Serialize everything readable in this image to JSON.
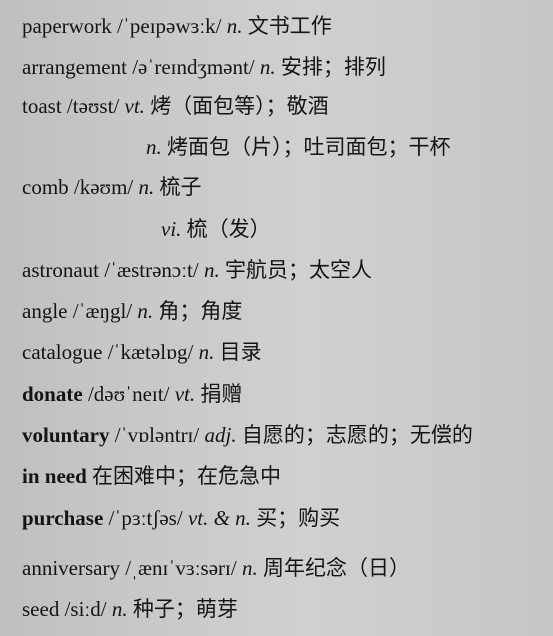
{
  "entries": [
    {
      "word": "paperwork",
      "phonetic": "/ˈpeɪpəwɜːk/",
      "pos": "n.",
      "meaning": "文书工作",
      "bold": false
    },
    {
      "word": "arrangement",
      "phonetic": "/əˈreɪndʒmənt/",
      "pos": "n.",
      "meaning": "安排；排列",
      "bold": false
    },
    {
      "word": "toast",
      "phonetic": "/təʊst/",
      "pos": "vt.",
      "meaning": "烤（面包等）；敬酒",
      "bold": false
    },
    {
      "word": "",
      "phonetic": "",
      "pos": "n.",
      "meaning": "烤面包（片）；吐司面包；干杯",
      "bold": false
    },
    {
      "word": "comb",
      "phonetic": "/kəʊm/",
      "pos": "n.",
      "meaning": "梳子",
      "bold": false
    },
    {
      "word": "",
      "phonetic": "",
      "pos": "vi.",
      "meaning": "梳（发）",
      "bold": false
    },
    {
      "word": "astronaut",
      "phonetic": "/ˈæstrənɔːt/",
      "pos": "n.",
      "meaning": "宇航员；太空人",
      "bold": false
    },
    {
      "word": "angle",
      "phonetic": "/ˈæŋgl/",
      "pos": "n.",
      "meaning": "角；角度",
      "bold": false
    },
    {
      "word": "catalogue",
      "phonetic": "/ˈkætəlɒg/",
      "pos": "n.",
      "meaning": "目录",
      "bold": false
    },
    {
      "word": "donate",
      "phonetic": "/dəʊˈneɪt/",
      "pos": "vt.",
      "meaning": "捐赠",
      "bold": true
    },
    {
      "word": "voluntary",
      "phonetic": "/ˈvɒləntrɪ/",
      "pos": "adj.",
      "meaning": "自愿的；志愿的；无偿的",
      "bold": true
    },
    {
      "word": "in need",
      "phonetic": "",
      "pos": "",
      "meaning": "在困难中；在危急中",
      "bold": true
    },
    {
      "word": "purchase",
      "phonetic": "/ˈpɜːtʃəs/",
      "pos": "vt. & n.",
      "meaning": "买；购买",
      "bold": true
    },
    {
      "word": "anniversary",
      "phonetic": "/ˌænɪˈvɜːsərɪ/",
      "pos": "n.",
      "meaning": "周年纪念（日）",
      "bold": false
    },
    {
      "word": "seed",
      "phonetic": "/siːd/",
      "pos": "n.",
      "meaning": "种子；萌芽",
      "bold": false
    }
  ]
}
